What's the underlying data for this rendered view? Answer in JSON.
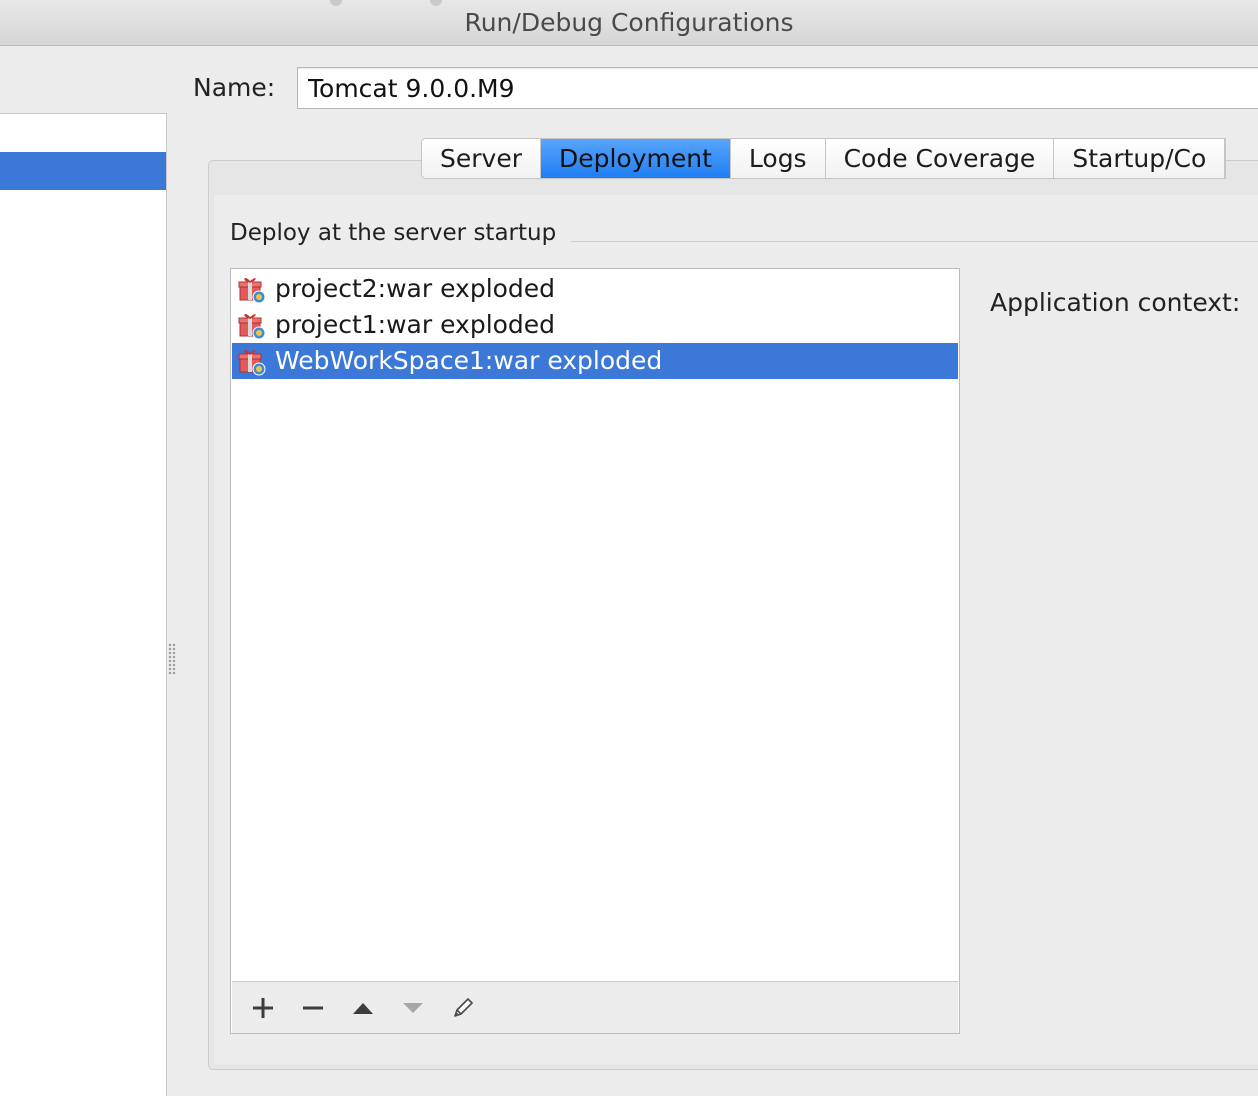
{
  "window": {
    "title": "Run/Debug Configurations"
  },
  "config": {
    "name_label": "Name:",
    "name_value": "Tomcat 9.0.0.M9"
  },
  "tabs": [
    {
      "label": "Server",
      "active": false
    },
    {
      "label": "Deployment",
      "active": true
    },
    {
      "label": "Logs",
      "active": false
    },
    {
      "label": "Code Coverage",
      "active": false
    },
    {
      "label": "Startup/Co",
      "active": false
    }
  ],
  "deployment": {
    "group_title": "Deploy at the server startup",
    "items": [
      {
        "label": "project2:war exploded",
        "icon": "war-exploded-icon",
        "selected": false
      },
      {
        "label": "project1:war exploded",
        "icon": "war-exploded-icon",
        "selected": false
      },
      {
        "label": "WebWorkSpace1:war exploded",
        "icon": "war-exploded-icon",
        "selected": true
      }
    ],
    "toolbar": [
      {
        "name": "add-icon",
        "label": "+"
      },
      {
        "name": "remove-icon",
        "label": "−"
      },
      {
        "name": "move-up-icon",
        "label": "▲"
      },
      {
        "name": "move-down-icon",
        "label": "▼"
      },
      {
        "name": "edit-icon",
        "label": "✎"
      }
    ],
    "app_context_label": "Application context:"
  },
  "colors": {
    "selection": "#3b78d8",
    "active_tab": "#2a86f5",
    "panel_bg": "#ececec"
  }
}
